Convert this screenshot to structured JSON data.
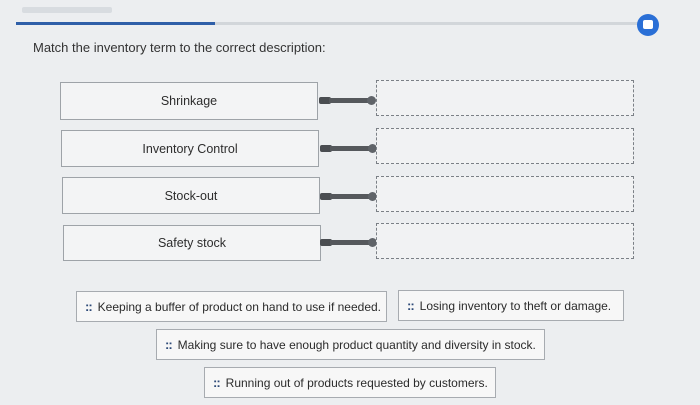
{
  "question": {
    "prompt": "Match the inventory term to the correct description:"
  },
  "terms": [
    {
      "label": "Shrinkage"
    },
    {
      "label": "Inventory Control"
    },
    {
      "label": "Stock-out"
    },
    {
      "label": "Safety stock"
    }
  ],
  "answers": [
    {
      "label": "Keeping a buffer of product on hand to use if needed."
    },
    {
      "label": "Losing inventory to theft or damage."
    },
    {
      "label": "Making sure to have enough product quantity and diversity in stock."
    },
    {
      "label": "Running out of products requested by customers."
    }
  ],
  "icons": {
    "drag_handle": "drag-handle-icon",
    "corner": "chat-icon"
  },
  "colors": {
    "accent": "#2f5fa8",
    "corner_icon": "#2a6fd6"
  }
}
